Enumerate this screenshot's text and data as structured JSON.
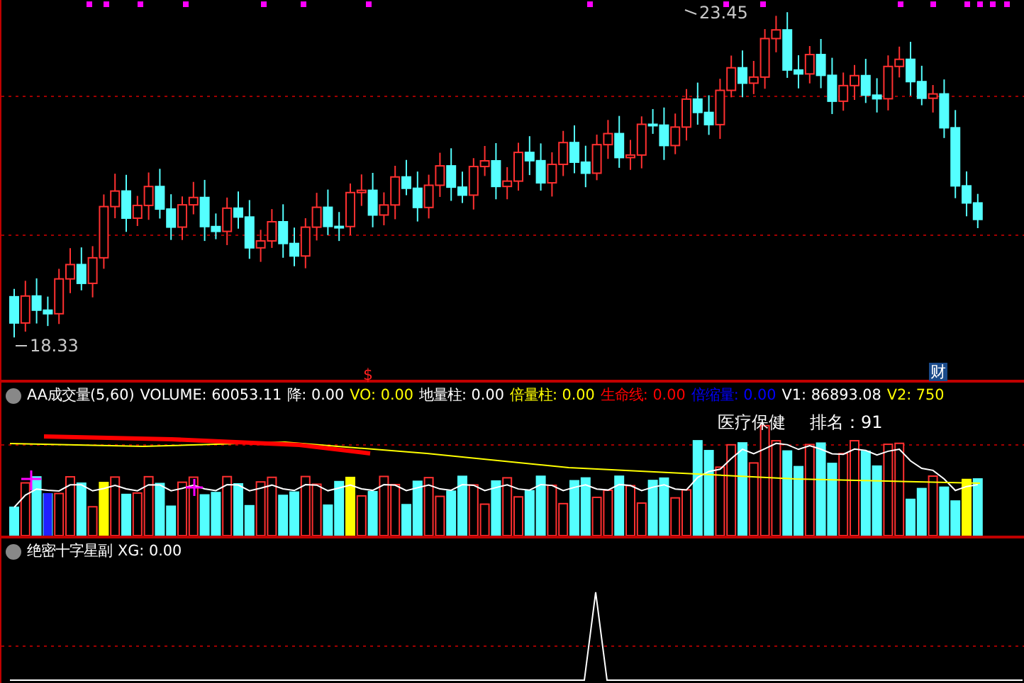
{
  "price_panel": {
    "high_label": "23.45",
    "low_label": "18.33",
    "event_marks": [
      {
        "kind": "dollar",
        "text": "$"
      },
      {
        "kind": "boxed",
        "text": "财"
      }
    ]
  },
  "volume_panel": {
    "title": "AA成交量(5,60)",
    "readings": [
      {
        "text": "VOLUME: 60053.11",
        "color": "#ffffff"
      },
      {
        "text": "降: 0.00",
        "color": "#ffffff"
      },
      {
        "text": "VO: 0.00",
        "color": "#ffff00"
      },
      {
        "text": "地量柱: 0.00",
        "color": "#ffffff"
      },
      {
        "text": "倍量柱: 0.00",
        "color": "#ffff00"
      },
      {
        "text": "生命线: 0.00",
        "color": "#ff0000"
      },
      {
        "text": "倍缩量: 0.00",
        "color": "#0000ff"
      },
      {
        "text": "V1: 86893.08",
        "color": "#ffffff"
      },
      {
        "text": "V2: 750",
        "color": "#ffff00"
      }
    ],
    "sector": "医疗保健",
    "rank": "排名：91"
  },
  "signal_panel": {
    "title": "绝密十字星副",
    "reading": "XG: 0.00"
  }
}
